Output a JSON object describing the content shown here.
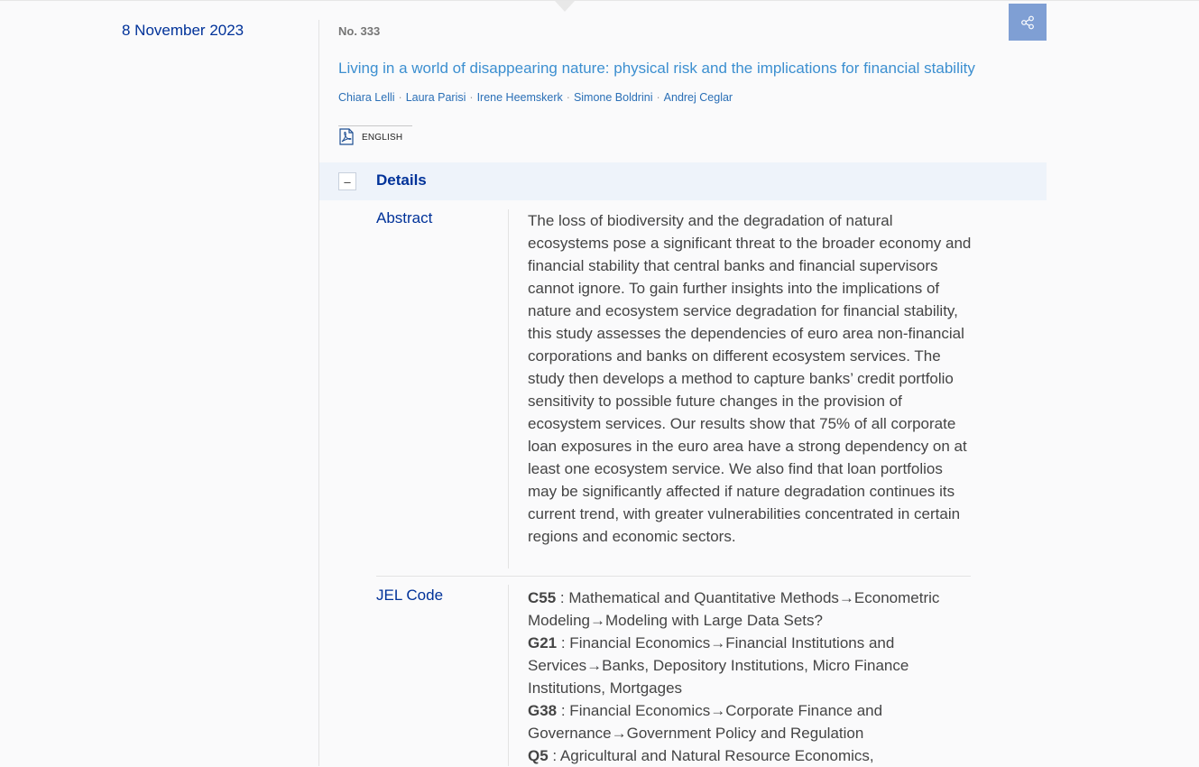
{
  "date": "8 November 2023",
  "number": "No. 333",
  "title": "Living in a world of disappearing nature: physical risk and the implications for financial stability",
  "authors": [
    "Chiara Lelli",
    "Laura Parisi",
    "Irene Heemskerk",
    "Simone Boldrini",
    "Andrej Ceglar"
  ],
  "language_label": "ENGLISH",
  "details": {
    "toggle_symbol": "–",
    "heading": "Details",
    "abstract_label": "Abstract",
    "abstract_text": "The loss of biodiversity and the degradation of natural ecosystems pose a significant threat to the broader economy and financial stability that central banks and financial supervisors cannot ignore. To gain further insights into the implications of nature and ecosystem service degradation for financial stability, this study assesses the dependencies of euro area non-financial corporations and banks on different ecosystem services. The study then develops a method to capture banks’ credit portfolio sensitivity to possible future changes in the provision of ecosystem services. Our results show that 75% of all corporate loan exposures in the euro area have a strong dependency on at least one ecosystem service. We also find that loan portfolios may be significantly affected if nature degradation continues its current trend, with greater vulnerabilities concentrated in certain regions and economic sectors.",
    "jel_label": "JEL Code",
    "jel_codes": [
      {
        "code": "C55",
        "desc": " : Mathematical and Quantitative Methods→Econometric Modeling→Modeling with Large Data Sets?"
      },
      {
        "code": "G21",
        "desc": " : Financial Economics→Financial Institutions and Services→Banks, Depository Institutions, Micro Finance Institutions, Mortgages"
      },
      {
        "code": "G38",
        "desc": " : Financial Economics→Corporate Finance and Governance→Government Policy and Regulation"
      },
      {
        "code": "Q5",
        "desc": " : Agricultural and Natural Resource Economics,"
      }
    ]
  },
  "colors": {
    "accent_blue": "#003299",
    "link_blue": "#3c8fd0",
    "share_button": "#7f9fd4",
    "details_bar": "#eef3fa"
  },
  "icons": {
    "share": "share-icon",
    "pdf": "pdf-icon"
  }
}
